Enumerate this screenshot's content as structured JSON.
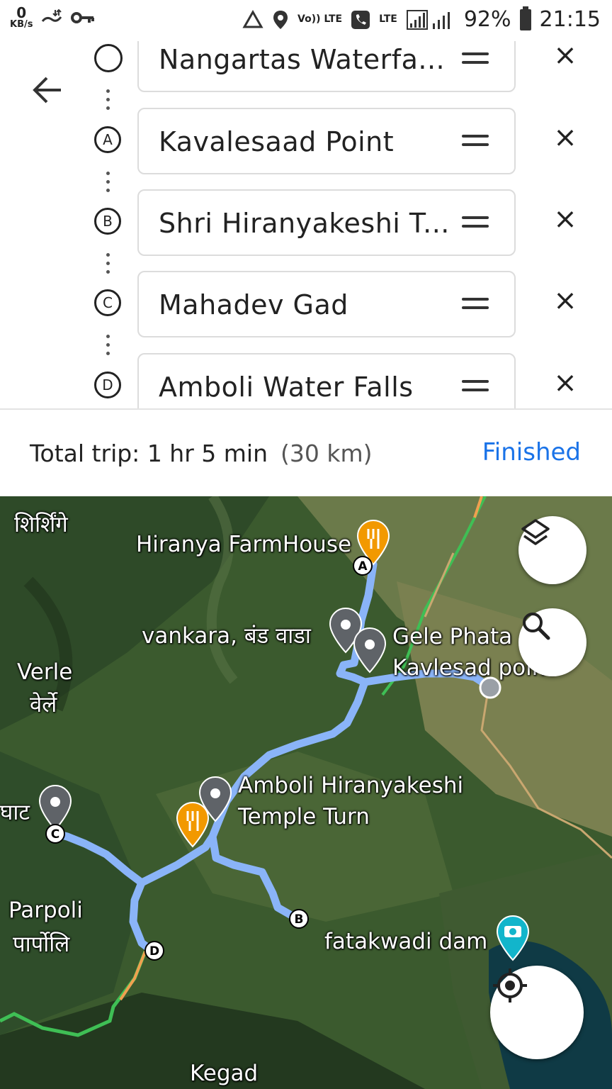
{
  "status_bar": {
    "speed_value": "0",
    "speed_unit": "KB/s",
    "volte": "Vo)) LTE",
    "lte": "LTE",
    "battery": "92%",
    "time": "21:15"
  },
  "stops": [
    {
      "marker": "",
      "name": "Nangartas Waterfa..."
    },
    {
      "marker": "A",
      "name": "Kavalesaad Point"
    },
    {
      "marker": "B",
      "name": "Shri Hiranyakeshi T..."
    },
    {
      "marker": "C",
      "name": "Mahadev Gad"
    },
    {
      "marker": "D",
      "name": "Amboli Water Falls"
    }
  ],
  "summary": {
    "label": "Total trip:",
    "duration": "1 hr 5 min",
    "distance": "(30 km)",
    "finished": "Finished"
  },
  "map": {
    "labels": {
      "shirshinge_partial": "शिर्शिंगे",
      "hiranya": "Hiranya FarmHouse",
      "vankara": "vankara, बंड वाडा",
      "gele": "Gele Phata",
      "kavlesad": "Kavlesad point",
      "verle": "Verle",
      "verle_mr": "वेर्ले",
      "amboli1": "Amboli Hiranyakeshi",
      "amboli2": "Temple Turn",
      "ghat": "घाट",
      "parpoli": "Parpoli",
      "parpoli_mr": "पार्पोलि",
      "fatakwadi": "fatakwadi dam",
      "kegad": "Kegad"
    },
    "markers": {
      "a": "A",
      "b": "B",
      "c": "C",
      "d": "D"
    },
    "route_color": "#8ab4f8",
    "icons": [
      "layers-icon",
      "search-icon",
      "my-location-icon"
    ]
  }
}
